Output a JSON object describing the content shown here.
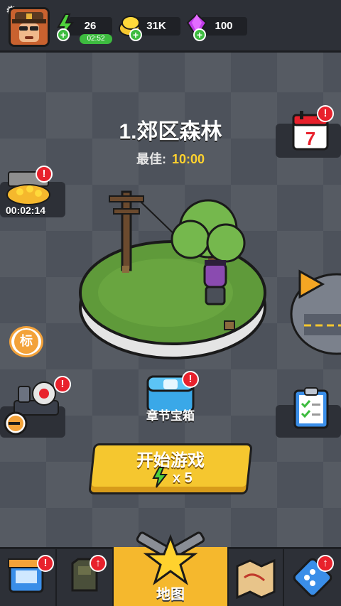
{
  "resources": {
    "energy": {
      "value": "26",
      "timer": "02:52",
      "icon": "lightning-icon"
    },
    "gold": {
      "value": "31K",
      "icon": "gold-coins-icon"
    },
    "gems": {
      "value": "100",
      "icon": "purple-gem-icon"
    }
  },
  "level": {
    "title": "1.郊区森林",
    "best_label": "最佳:",
    "best_value": "10:00"
  },
  "left_panels": {
    "chest_timer": "00:02:14",
    "marker_label": "标"
  },
  "chapter_chest": {
    "label": "章节宝箱"
  },
  "start_button": {
    "label": "开始游戏",
    "cost": "x 5"
  },
  "badges": {
    "exclaim": "!",
    "up": "↑"
  },
  "bottom_nav": {
    "active_label": "地图"
  },
  "colors": {
    "accent_yellow": "#f5c72f",
    "badge_red": "#e8212c",
    "plus_green": "#3dbb3f",
    "panel_dark": "#2d3037"
  }
}
